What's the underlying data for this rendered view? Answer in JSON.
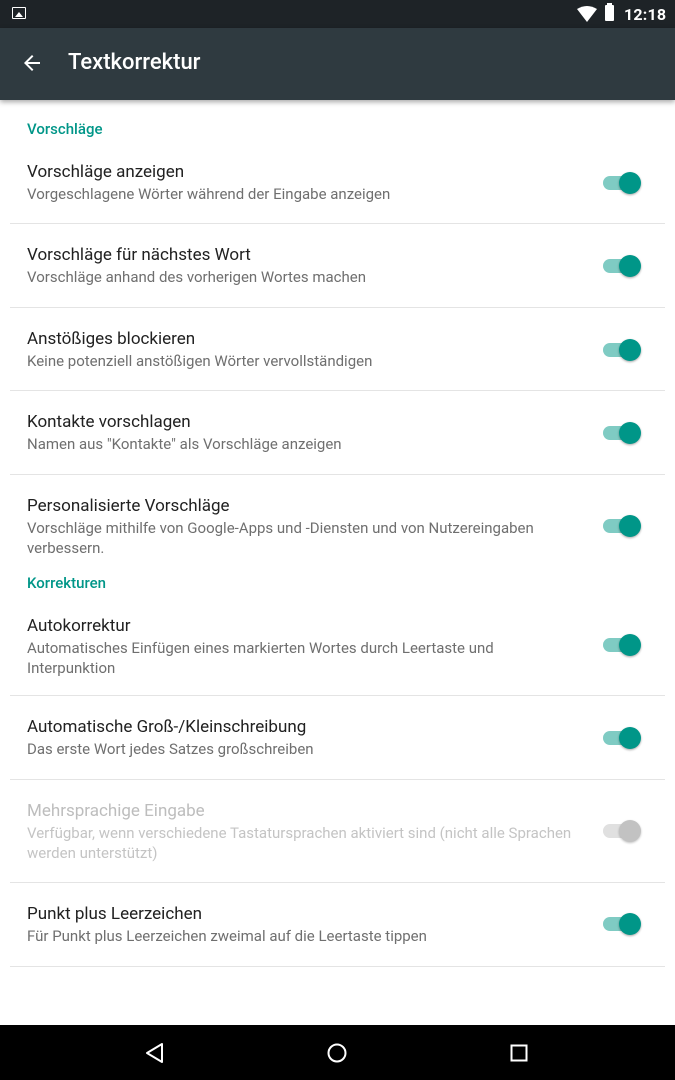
{
  "status_bar": {
    "time": "12:18",
    "icons": [
      "image-icon",
      "wifi-icon",
      "battery-icon"
    ]
  },
  "app_bar": {
    "title": "Textkorrektur",
    "back_icon": "arrow-left-icon"
  },
  "sections": [
    {
      "header": "Vorschläge",
      "items": [
        {
          "title": "Vorschläge anzeigen",
          "summary": "Vorgeschlagene Wörter während der Eingabe anzeigen",
          "checked": true,
          "enabled": true
        },
        {
          "title": "Vorschläge für nächstes Wort",
          "summary": "Vorschläge anhand des vorherigen Wortes machen",
          "checked": true,
          "enabled": true
        },
        {
          "title": "Anstößiges blockieren",
          "summary": "Keine potenziell anstößigen Wörter vervollständigen",
          "checked": true,
          "enabled": true
        },
        {
          "title": "Kontakte vorschlagen",
          "summary": "Namen aus \"Kontakte\" als Vorschläge anzeigen",
          "checked": true,
          "enabled": true
        },
        {
          "title": "Personalisierte Vorschläge",
          "summary": "Vorschläge mithilfe von Google-Apps und -Diensten und von Nutzereingaben verbessern.",
          "checked": true,
          "enabled": true
        }
      ]
    },
    {
      "header": "Korrekturen",
      "items": [
        {
          "title": "Autokorrektur",
          "summary": "Automatisches Einfügen eines markierten Wortes durch Leertaste und Interpunktion",
          "checked": true,
          "enabled": true
        },
        {
          "title": "Automatische Groß-/Kleinschreibung",
          "summary": "Das erste Wort jedes Satzes großschreiben",
          "checked": true,
          "enabled": true
        },
        {
          "title": "Mehrsprachige Eingabe",
          "summary": "Verfügbar, wenn verschiedene Tastatursprachen aktiviert sind (nicht alle Sprachen werden unterstützt)",
          "checked": true,
          "enabled": false
        },
        {
          "title": "Punkt plus Leerzeichen",
          "summary": "Für Punkt plus Leerzeichen zweimal auf die Leertaste tippen",
          "checked": true,
          "enabled": true
        }
      ]
    }
  ],
  "nav_bar": {
    "buttons": [
      "back-icon",
      "home-icon",
      "recents-icon"
    ]
  },
  "colors": {
    "accent": "#009688",
    "app_bar": "#2f3a40",
    "status_bar": "#1e2327"
  }
}
